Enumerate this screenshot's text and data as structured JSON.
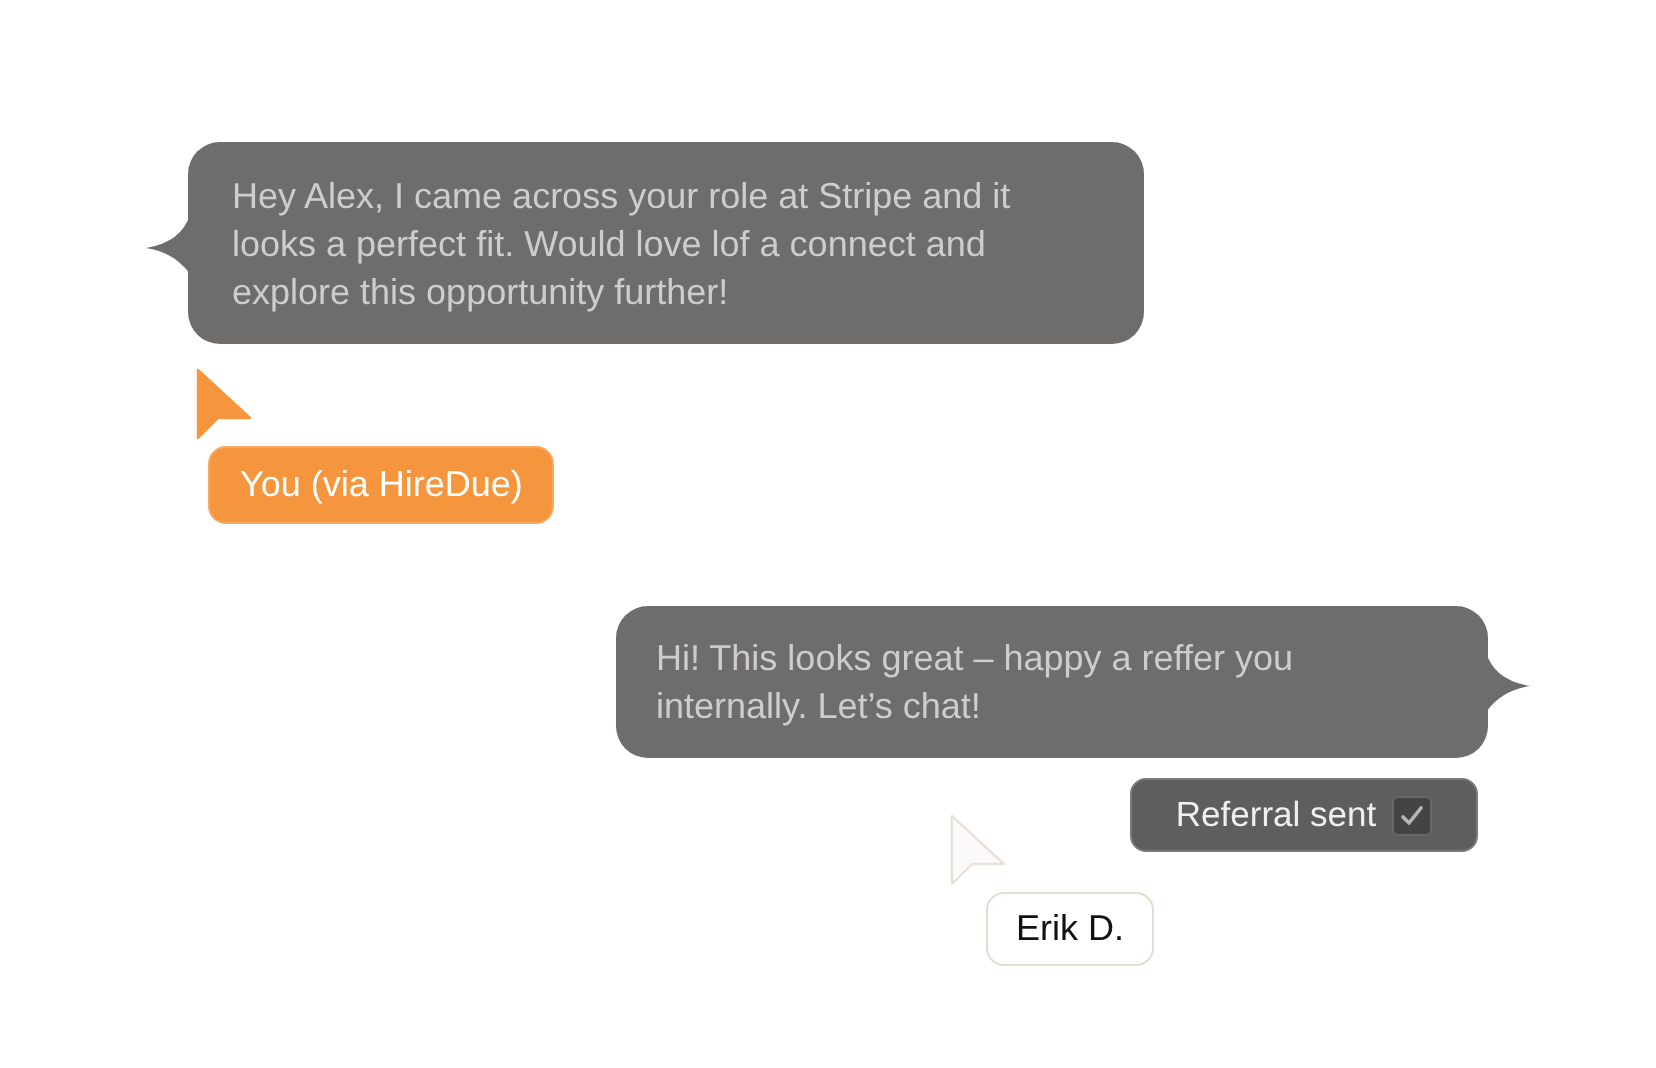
{
  "messages": [
    {
      "kind": "tail-left",
      "text": "Hey Alex, I came across your role at Stripe and it looks a perfect fit. Would love lof a connect and explore this opportunity further!"
    },
    {
      "kind": "tail-right",
      "text": "Hi! This looks great – happy a reffer you internally. Let’s chat!"
    }
  ],
  "status": {
    "label": "Referral sent",
    "checked": true
  },
  "cursors": [
    {
      "kind": "accent",
      "label": "You (via HireDue)"
    },
    {
      "kind": "plain",
      "label": "Erik D."
    }
  ]
}
